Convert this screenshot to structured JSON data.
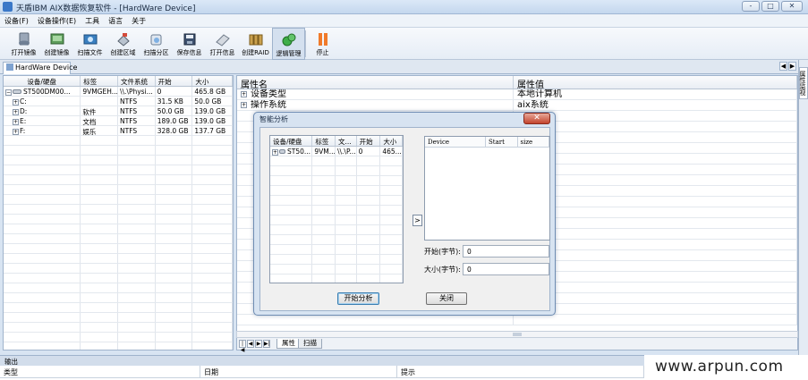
{
  "window": {
    "title": "天盾IBM AIX数据恢复软件 - [HardWare Device]",
    "buttons": [
      "-",
      "□",
      "✕"
    ]
  },
  "menu": [
    "设备(F)",
    "设备操作(E)",
    "工具",
    "语言",
    "关于"
  ],
  "toolbar": [
    {
      "label": "打开镜像",
      "icon": "open-image-icon"
    },
    {
      "label": "创建镜像",
      "icon": "create-image-icon"
    },
    {
      "label": "扫描文件",
      "icon": "scan-files-icon"
    },
    {
      "label": "创建区域",
      "icon": "create-region-icon"
    },
    {
      "label": "扫描分区",
      "icon": "scan-partition-icon"
    },
    {
      "label": "保存信息",
      "icon": "save-info-icon"
    },
    {
      "label": "打开信息",
      "icon": "open-info-icon"
    },
    {
      "label": "创建RAID",
      "icon": "create-raid-icon"
    },
    {
      "label": "逻辑管理",
      "icon": "logic-manage-icon"
    },
    {
      "label": "停止",
      "icon": "stop-icon"
    }
  ],
  "doc_tab": "HardWare Device",
  "right_strip_tab": "属性监视",
  "device_table": {
    "headers": [
      "设备/硬盘",
      "标签",
      "文件系统",
      "开始",
      "大小"
    ],
    "rows": [
      [
        "ST500DM00...",
        "9VMGEH...",
        "\\\\.\\Physi...",
        "0",
        "465.8 GB"
      ],
      [
        "C:",
        "",
        "NTFS",
        "31.5 KB",
        "50.0 GB"
      ],
      [
        "D:",
        "软件",
        "NTFS",
        "50.0 GB",
        "139.0 GB"
      ],
      [
        "E:",
        "文档",
        "NTFS",
        "189.0 GB",
        "139.0 GB"
      ],
      [
        "F:",
        "娱乐",
        "NTFS",
        "328.0 GB",
        "137.7 GB"
      ]
    ]
  },
  "property_table": {
    "headers": [
      "属性名",
      "属性值"
    ],
    "rows": [
      [
        "设备类型",
        "本地计算机"
      ],
      [
        "操作系统",
        "aix系统"
      ]
    ]
  },
  "bottom_tabs": [
    "属性",
    "扫描"
  ],
  "output": {
    "title": "输出",
    "headers": [
      "类型",
      "日期",
      "提示"
    ]
  },
  "watermark": "www.arpun.com",
  "dialog": {
    "title": "智能分析",
    "close": "✕",
    "grid": {
      "headers": [
        "设备/硬盘",
        "标签",
        "文...",
        "开始",
        "大小"
      ],
      "row": [
        "ST50...",
        "9VM...",
        "\\\\.\\P...",
        "0",
        "465...."
      ]
    },
    "move_button": ">",
    "list_headers": [
      "Device",
      "Start",
      "size"
    ],
    "start_label": "开始(字节):",
    "start_value": "0",
    "size_label": "大小(字节):",
    "size_value": "0",
    "analyze_button": "开始分析",
    "close_button": "关闭"
  }
}
